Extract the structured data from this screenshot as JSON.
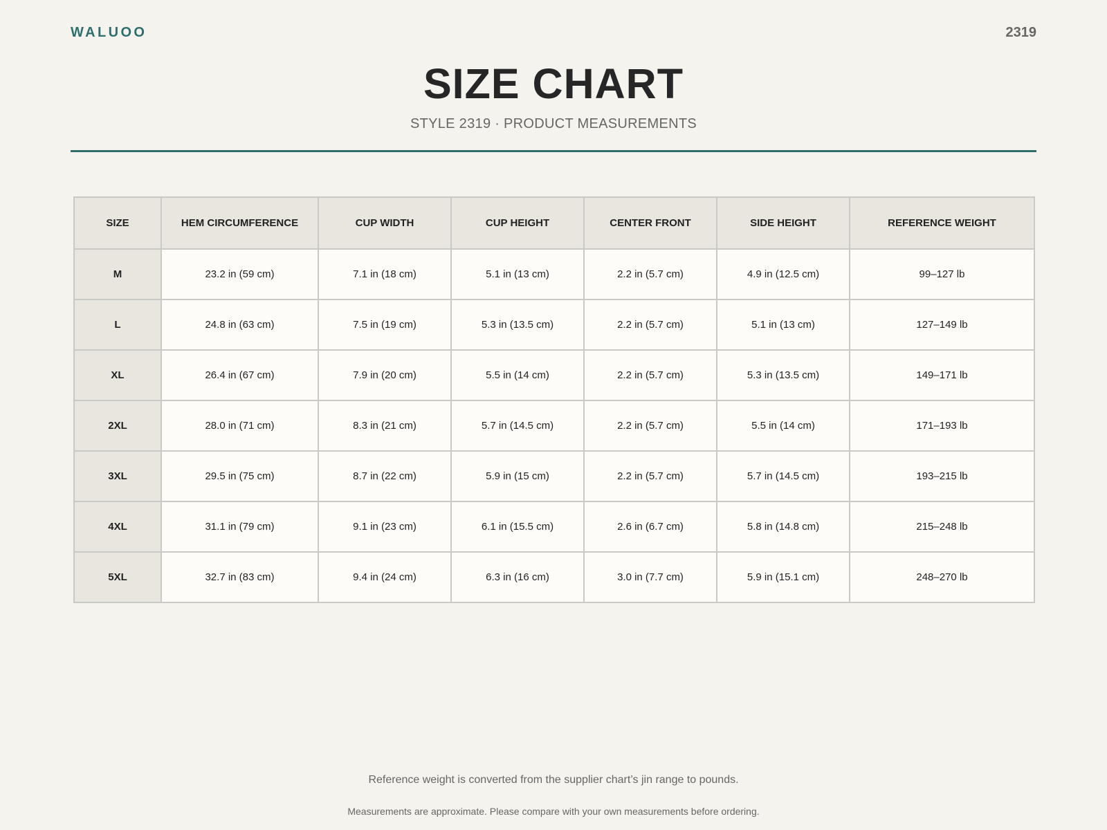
{
  "header": {
    "brand": "WALUOO",
    "style_code": "2319",
    "title": "SIZE CHART",
    "subtitle": "STYLE 2319 · PRODUCT MEASUREMENTS"
  },
  "colors": {
    "accent": "#2f6e6e",
    "background": "#f4f3ee",
    "header_cell": "#e9e6e0",
    "body_cell": "#fdfcf9"
  },
  "table": {
    "columns": [
      "SIZE",
      "HEM CIRCUMFERENCE",
      "CUP WIDTH",
      "CUP HEIGHT",
      "CENTER FRONT",
      "SIDE HEIGHT",
      "REFERENCE WEIGHT"
    ],
    "rows": [
      [
        "M",
        "23.2 in (59 cm)",
        "7.1 in (18 cm)",
        "5.1 in (13 cm)",
        "2.2 in (5.7 cm)",
        "4.9 in (12.5 cm)",
        "99–127 lb"
      ],
      [
        "L",
        "24.8 in (63 cm)",
        "7.5 in (19 cm)",
        "5.3 in (13.5 cm)",
        "2.2 in (5.7 cm)",
        "5.1 in (13 cm)",
        "127–149 lb"
      ],
      [
        "XL",
        "26.4 in (67 cm)",
        "7.9 in (20 cm)",
        "5.5 in (14 cm)",
        "2.2 in (5.7 cm)",
        "5.3 in (13.5 cm)",
        "149–171 lb"
      ],
      [
        "2XL",
        "28.0 in (71 cm)",
        "8.3 in (21 cm)",
        "5.7 in (14.5 cm)",
        "2.2 in (5.7 cm)",
        "5.5 in (14 cm)",
        "171–193 lb"
      ],
      [
        "3XL",
        "29.5 in (75 cm)",
        "8.7 in (22 cm)",
        "5.9 in (15 cm)",
        "2.2 in (5.7 cm)",
        "5.7 in (14.5 cm)",
        "193–215 lb"
      ],
      [
        "4XL",
        "31.1 in (79 cm)",
        "9.1 in (23 cm)",
        "6.1 in (15.5 cm)",
        "2.6 in (6.7 cm)",
        "5.8 in (14.8 cm)",
        "215–248 lb"
      ],
      [
        "5XL",
        "32.7 in (83 cm)",
        "9.4 in (24 cm)",
        "6.3 in (16 cm)",
        "3.0 in (7.7 cm)",
        "5.9 in (15.1 cm)",
        "248–270 lb"
      ]
    ]
  },
  "footer": {
    "note_weight": "Reference weight is converted from the supplier chart’s jin range to pounds.",
    "note_measure": "Measurements are approximate. Please compare with your own measurements before ordering."
  }
}
